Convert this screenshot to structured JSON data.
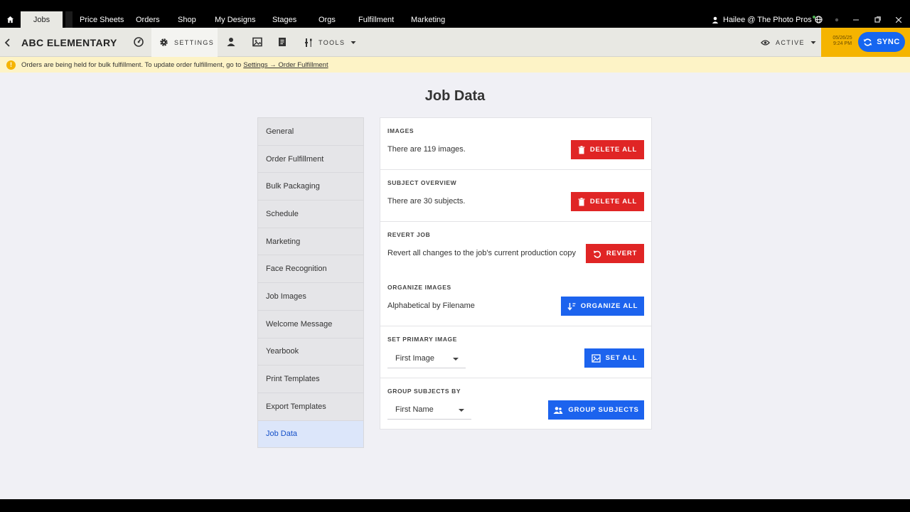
{
  "topnav": {
    "active_tab": "Jobs",
    "items": [
      "Price Sheets",
      "Orders",
      "Shop",
      "My Designs",
      "Stages",
      "Orgs",
      "Fulfillment",
      "Marketing"
    ],
    "user": "Hailee @ The Photo Pros"
  },
  "toolbar": {
    "job_name": "ABC ELEMENTARY",
    "settings_label": "SETTINGS",
    "tools_label": "TOOLS",
    "active_label": "ACTIVE",
    "sync_date": "05/26/25",
    "sync_time": "9:24 PM",
    "sync_label": "SYNC"
  },
  "notice": {
    "text": "Orders are being held for bulk fulfillment. To update order fulfillment, go to",
    "link": "Settings → Order Fulfillment"
  },
  "page": {
    "title": "Job Data"
  },
  "sidebar": {
    "items": [
      "General",
      "Order Fulfillment",
      "Bulk Packaging",
      "Schedule",
      "Marketing",
      "Face Recognition",
      "Job Images",
      "Welcome Message",
      "Yearbook",
      "Print Templates",
      "Export Templates",
      "Job Data"
    ],
    "selected": "Job Data"
  },
  "sections": {
    "images": {
      "title": "IMAGES",
      "text": "There are 119 images.",
      "button": "DELETE ALL"
    },
    "subjects": {
      "title": "SUBJECT OVERVIEW",
      "text": "There are 30 subjects.",
      "button": "DELETE ALL"
    },
    "revert": {
      "title": "REVERT JOB",
      "text": "Revert all changes to the job's current production copy",
      "button": "REVERT"
    },
    "organize": {
      "title": "ORGANIZE IMAGES",
      "text": "Alphabetical by Filename",
      "button": "ORGANIZE ALL"
    },
    "primary": {
      "title": "SET PRIMARY IMAGE",
      "select_value": "First Image",
      "button": "SET ALL"
    },
    "group": {
      "title": "GROUP SUBJECTS BY",
      "select_value": "First Name",
      "button": "GROUP SUBJECTS"
    }
  },
  "colors": {
    "danger": "#e02525",
    "primary": "#1c63ee",
    "sync_bg": "#f5b400",
    "notice_bg": "#fdf3c6"
  }
}
